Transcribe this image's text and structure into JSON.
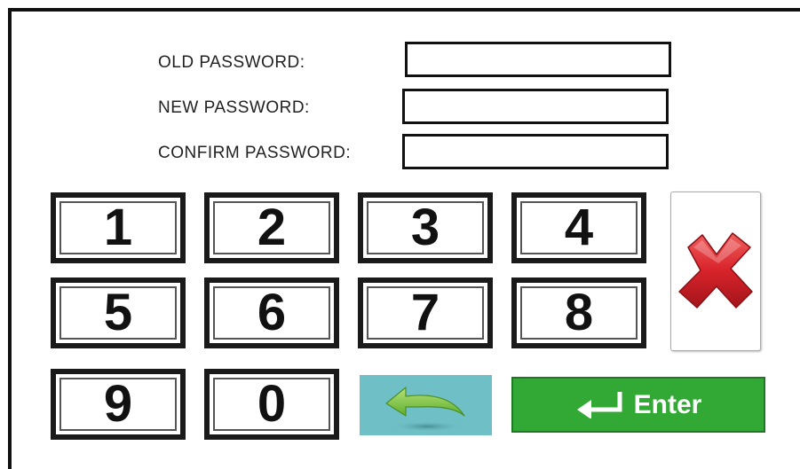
{
  "form": {
    "old_password_label": "OLD PASSWORD:",
    "new_password_label": "NEW PASSWORD:",
    "confirm_password_label": "CONFIRM PASSWORD:",
    "old_password_value": "",
    "new_password_value": "",
    "confirm_password_value": ""
  },
  "keypad": {
    "keys": [
      "1",
      "2",
      "3",
      "4",
      "5",
      "6",
      "7",
      "8",
      "9",
      "0"
    ]
  },
  "actions": {
    "cancel_icon": "red-x-icon",
    "back_icon": "green-back-arrow-icon",
    "enter_icon": "return-arrow-icon",
    "enter_label": "Enter"
  },
  "colors": {
    "cancel": "#d8232a",
    "back_bg": "#6fc0c6",
    "back_arrow": "#7cc142",
    "enter_bg": "#33a935",
    "key_border": "#1a1a1a"
  }
}
